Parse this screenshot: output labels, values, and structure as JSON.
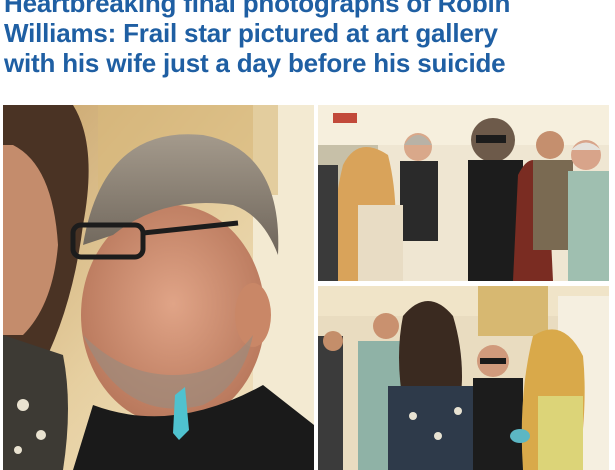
{
  "article": {
    "headline_lines": [
      "Heartbreaking final photographs of Robin",
      "Williams: Frail star pictured at art gallery",
      "with his wife just a day before his suicide"
    ]
  },
  "colors": {
    "headline": "#1f5fa3",
    "background": "#ffffff"
  }
}
